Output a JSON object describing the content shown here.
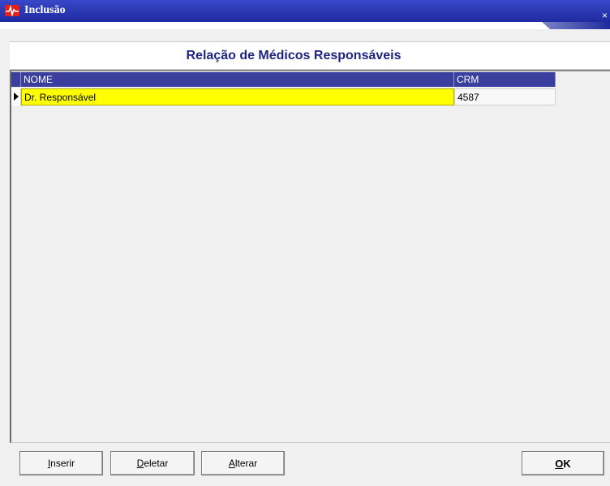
{
  "window": {
    "title": "Inclusão",
    "close_glyph": "×"
  },
  "header": {
    "title": "Relação de Médicos Responsáveis"
  },
  "table": {
    "columns": [
      "NOME",
      "CRM"
    ],
    "rows": [
      {
        "nome": "Dr. Responsável",
        "crm": "4587"
      }
    ]
  },
  "buttons": {
    "inserir": {
      "underline": "I",
      "rest": "nserir"
    },
    "deletar": {
      "underline": "D",
      "rest": "eletar"
    },
    "alterar": {
      "underline": "A",
      "rest": "lterar"
    },
    "ok": {
      "underline": "O",
      "rest": "K"
    }
  },
  "colors": {
    "title_bar": "#1e2aa0",
    "grid_header": "#3a3f9e",
    "selected_cell": "#ffff00",
    "header_text": "#1d2580",
    "app_icon": "#e0211c"
  },
  "icons": [
    "app-heartbeat-icon",
    "close-icon",
    "row-indicator-icon"
  ]
}
